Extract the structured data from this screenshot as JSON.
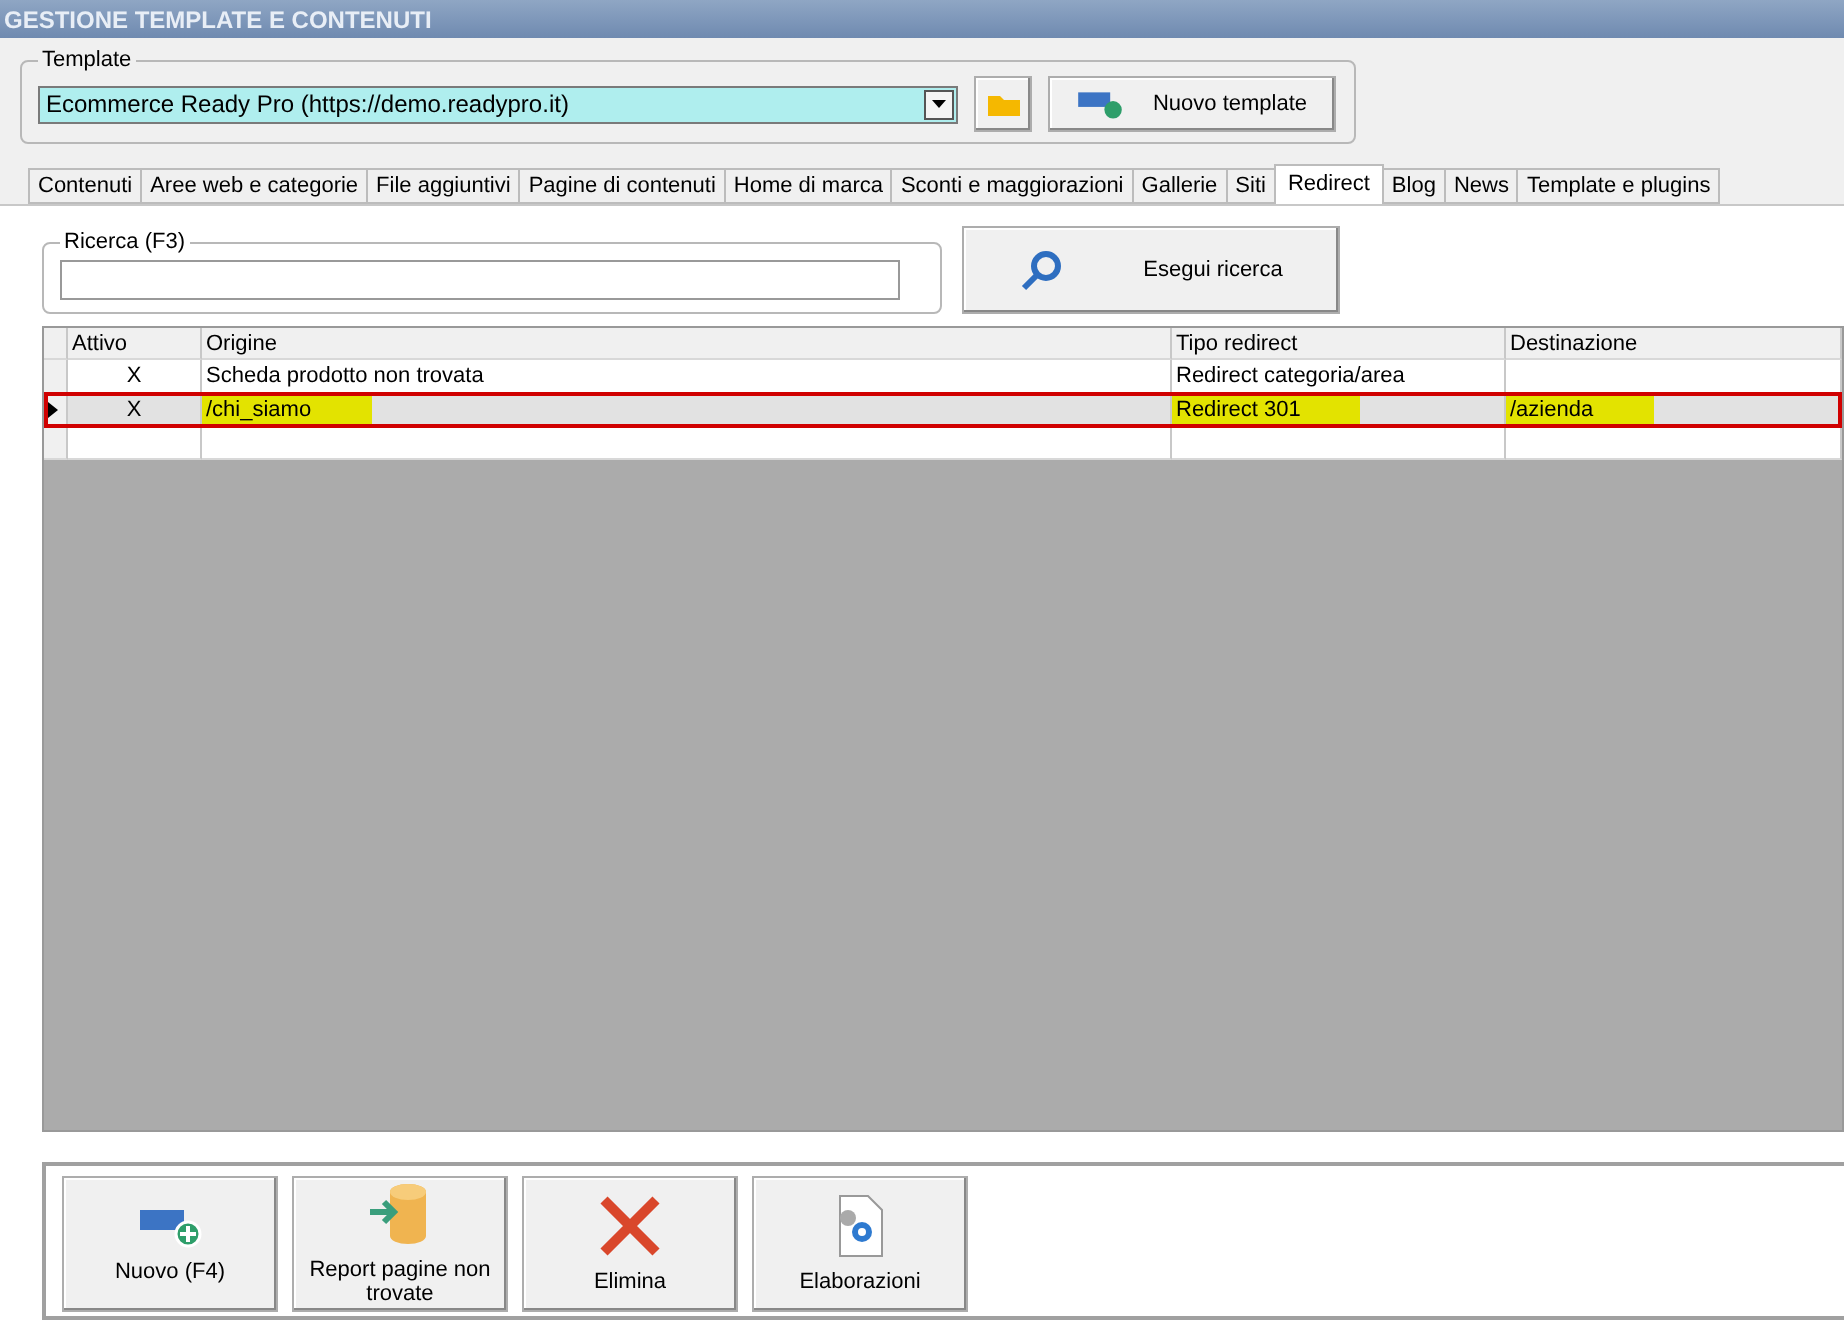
{
  "window": {
    "title": "GESTIONE TEMPLATE E CONTENUTI"
  },
  "template_group": {
    "label": "Template",
    "value": "Ecommerce Ready Pro (https://demo.readypro.it)",
    "new_button": "Nuovo template"
  },
  "tabs": [
    {
      "label": "Contenuti",
      "selected": false
    },
    {
      "label": "Aree web e categorie",
      "selected": false
    },
    {
      "label": "File aggiuntivi",
      "selected": false
    },
    {
      "label": "Pagine di contenuti",
      "selected": false
    },
    {
      "label": "Home di marca",
      "selected": false
    },
    {
      "label": "Sconti e maggiorazioni",
      "selected": false
    },
    {
      "label": "Gallerie",
      "selected": false
    },
    {
      "label": "Siti",
      "selected": false
    },
    {
      "label": "Redirect",
      "selected": true
    },
    {
      "label": "Blog",
      "selected": false
    },
    {
      "label": "News",
      "selected": false
    },
    {
      "label": "Template e plugins",
      "selected": false
    }
  ],
  "search": {
    "label": "Ricerca (F3)",
    "button": "Esegui ricerca"
  },
  "table": {
    "columns": [
      "Attivo",
      "Origine",
      "Tipo redirect",
      "Destinazione"
    ],
    "rows": [
      {
        "selected": false,
        "cells": [
          {
            "text": "X",
            "highlighted": false
          },
          {
            "text": "Scheda prodotto non trovata",
            "highlighted": false
          },
          {
            "text": "Redirect categoria/area",
            "highlighted": false
          }
        ]
      },
      {
        "selected": true,
        "cells": [
          {
            "text": "X",
            "highlighted": false
          },
          {
            "text": "/chi_siamo",
            "highlighted": true
          },
          {
            "text": "Redirect 301",
            "highlighted": true
          },
          {
            "text": "/azienda",
            "highlighted": true
          }
        ]
      }
    ]
  },
  "actions": [
    {
      "kind": "new",
      "label": "Nuovo (F4)"
    },
    {
      "kind": "report",
      "label": "Report pagine non trovate"
    },
    {
      "kind": "delete",
      "label": "Elimina"
    },
    {
      "kind": "process",
      "label": "Elaborazioni"
    }
  ]
}
